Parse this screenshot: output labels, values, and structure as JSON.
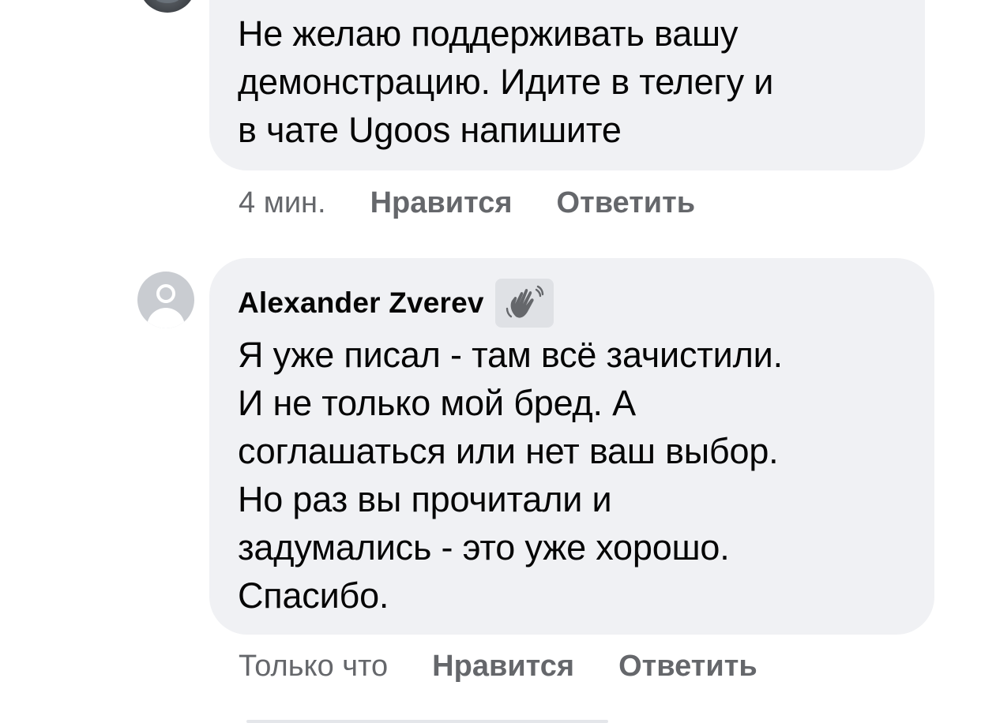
{
  "comments": [
    {
      "text_lines": [
        "Не желаю поддерживать вашу",
        "демонстрацию. Идите в телегу и",
        "в чате Ugoos напишите"
      ],
      "time": "4 мин.",
      "like_label": "Нравится",
      "reply_label": "Ответить"
    },
    {
      "author": "Alexander Zverev",
      "badge_icon": "waving-hand-icon",
      "text_lines": [
        "Я уже писал - там всё зачистили.",
        "И не только мой бред. А",
        "соглашаться или нет ваш выбор.",
        "Но раз вы прочитали и",
        "задумались - это уже хорошо.",
        "Спасибо."
      ],
      "time": "Только что",
      "like_label": "Нравится",
      "reply_label": "Ответить"
    }
  ],
  "colors": {
    "bubble_bg": "#f0f1f4",
    "text": "#050505",
    "meta": "#65676b",
    "avatar_default": "#c9ccd1"
  }
}
